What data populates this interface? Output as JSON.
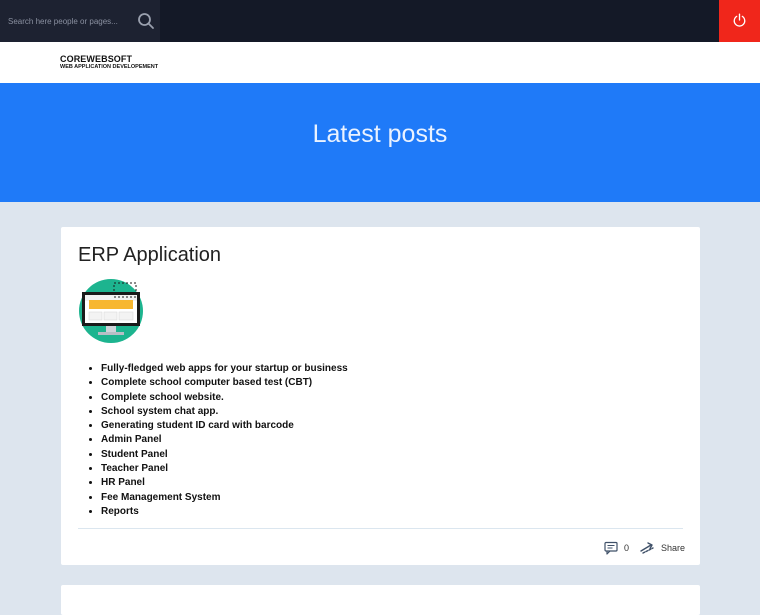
{
  "header": {
    "search_placeholder": "Search here people or pages...",
    "icons": {
      "search": "search-icon",
      "power": "power-icon"
    },
    "colors": {
      "topbar": "#141927",
      "power_button": "#f0261b"
    }
  },
  "brand": {
    "name": "COREWEBSOFT",
    "tagline": "WEB APPLICATION DEVELOPEMENT"
  },
  "hero": {
    "title": "Latest posts",
    "color": "#1f7af8"
  },
  "post": {
    "title": "ERP Application",
    "image": "computer-monitor-illustration",
    "features": [
      "Fully-fledged web apps for your startup or business",
      "Complete school computer based test (CBT)",
      "Complete school website.",
      "School system chat app.",
      "Generating student ID card with barcode",
      "Admin Panel",
      "Student Panel",
      "Teacher Panel",
      "HR Panel",
      "Fee Management System",
      "Reports"
    ],
    "comments_count": "0",
    "share_label": "Share",
    "icons": {
      "comments": "comments-icon",
      "share": "share-icon"
    }
  }
}
